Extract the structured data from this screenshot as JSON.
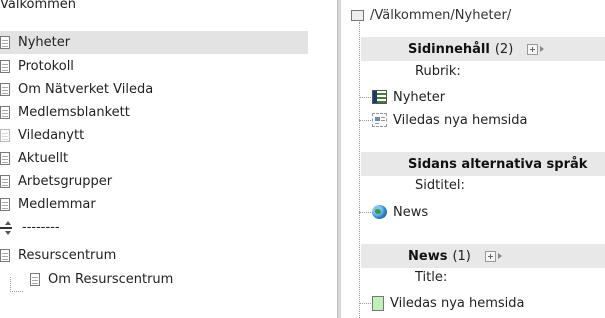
{
  "tree": {
    "items": [
      {
        "label": "Välkommen"
      },
      {
        "label": "Nyheter"
      },
      {
        "label": "Protokoll"
      },
      {
        "label": "Om Nätverket Vileda"
      },
      {
        "label": "Medlemsblankett"
      },
      {
        "label": "Viledanytt"
      },
      {
        "label": "Aktuellt"
      },
      {
        "label": "Arbetsgrupper"
      },
      {
        "label": "Medlemmar"
      },
      {
        "label": "--------"
      },
      {
        "label": "Resurscentrum"
      },
      {
        "label": "Om Resurscentrum"
      }
    ]
  },
  "main": {
    "path": "/Välkommen/Nyheter/",
    "sections": [
      {
        "title": "Sidinnehåll",
        "count": "(2)",
        "field_label": "Rubrik:",
        "items": [
          {
            "label": "Nyheter",
            "icon": "list-page-icon"
          },
          {
            "label": "Viledas nya hemsida",
            "icon": "article-icon"
          }
        ]
      },
      {
        "title": "Sidans alternativa språk",
        "count": "",
        "field_label": "Sidtitel:",
        "items": [
          {
            "label": "News",
            "icon": "globe-icon"
          }
        ]
      },
      {
        "title": "News",
        "count": "(1)",
        "field_label": "Title:",
        "items": [
          {
            "label": "Viledas nya hemsida",
            "icon": "page-icon"
          }
        ]
      }
    ]
  },
  "colors": {
    "selected_bg": "#e3e3e3",
    "header_bg": "#e8e8e8",
    "divider": "#d7d7d7"
  }
}
